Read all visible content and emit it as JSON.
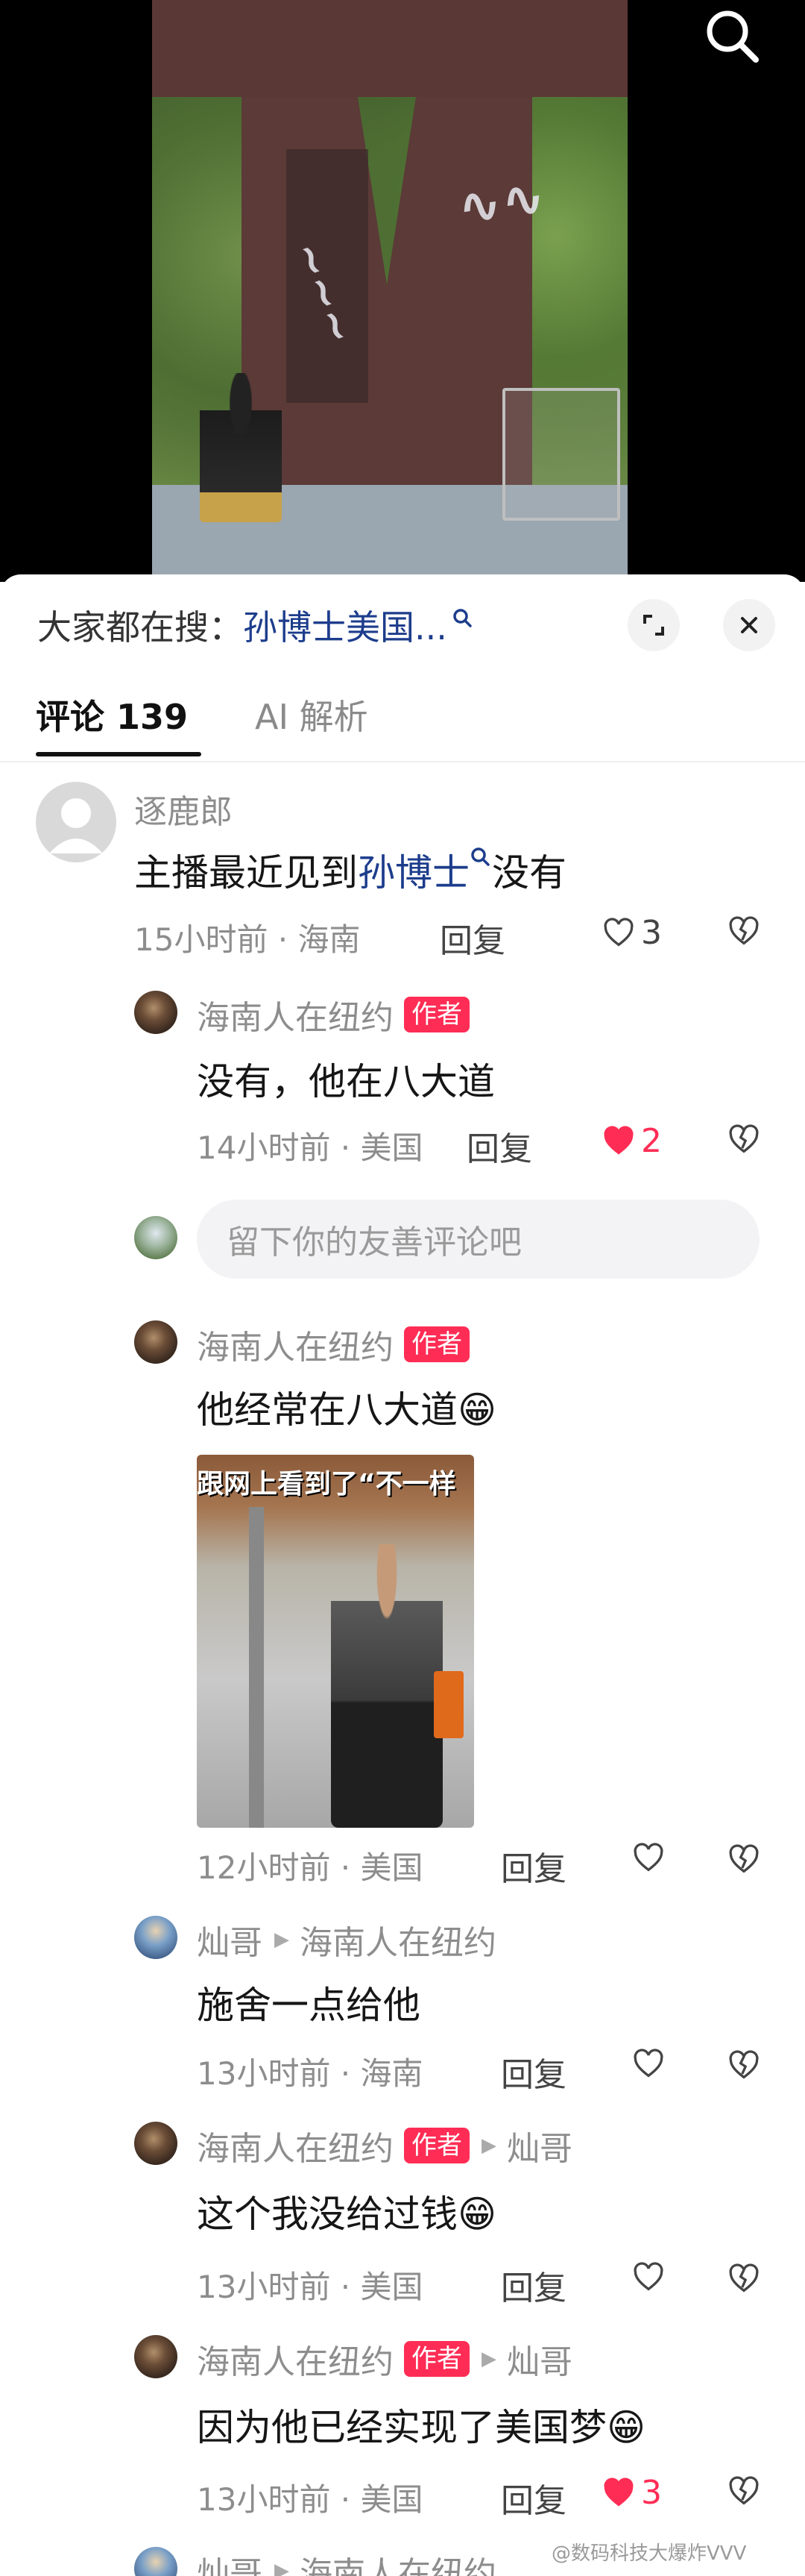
{
  "header": {
    "trending_label": "大家都在搜：",
    "trending_keyword": "孙博士美国..."
  },
  "tabs": [
    {
      "label": "评论 139",
      "active": true
    },
    {
      "label": "AI 解析",
      "active": false
    }
  ],
  "reply_input": {
    "placeholder": "留下你的友善评论吧"
  },
  "comments": [
    {
      "user": "逐鹿郎",
      "text_before": "主播最近见到",
      "text_link": "孙博士",
      "text_after": "没有",
      "time": "15小时前 · 海南",
      "reply_label": "回复",
      "likes": "3",
      "liked": false
    },
    {
      "user": "海南人在纽约",
      "tag": "作者",
      "text": "没有，他在八大道",
      "time": "14小时前 · 美国",
      "reply_label": "回复",
      "likes": "2",
      "liked": true
    },
    {
      "user": "海南人在纽约",
      "tag": "作者",
      "text": "他经常在八大道😁",
      "image_caption": "跟网上看到了“不一样",
      "time": "12小时前 · 美国",
      "reply_label": "回复",
      "likes": "",
      "liked": false
    },
    {
      "user": "灿哥",
      "reply_to": "海南人在纽约",
      "text": "施舍一点给他",
      "time": "13小时前 · 海南",
      "reply_label": "回复",
      "likes": "",
      "liked": false
    },
    {
      "user": "海南人在纽约",
      "tag": "作者",
      "reply_to": "灿哥",
      "text": "这个我没给过钱😁",
      "time": "13小时前 · 美国",
      "reply_label": "回复",
      "likes": "",
      "liked": false
    },
    {
      "user": "海南人在纽约",
      "tag": "作者",
      "reply_to": "灿哥",
      "text": "因为他已经实现了美国梦😁",
      "time": "13小时前 · 美国",
      "reply_label": "回复",
      "likes": "3",
      "liked": true
    },
    {
      "user": "灿哥",
      "reply_to": "海南人在纽约"
    }
  ],
  "watermark": "@数码科技大爆炸VVV",
  "colors": {
    "accent": "#ff2d55",
    "link": "#1d3d8c"
  }
}
